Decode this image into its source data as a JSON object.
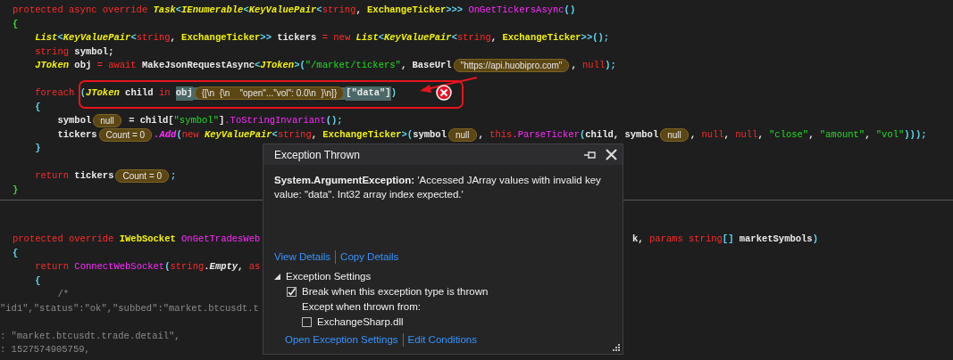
{
  "editor": {
    "blocks": [
      {
        "lines": [
          {
            "tokens": [
              {
                "kind": "kw",
                "text": "protected async override "
              },
              {
                "kind": "type",
                "text": "Task"
              },
              {
                "kind": "punct",
                "text": "<"
              },
              {
                "kind": "type",
                "text": "IEnumerable"
              },
              {
                "kind": "punct",
                "text": "<"
              },
              {
                "kind": "type",
                "text": "KeyValuePair"
              },
              {
                "kind": "punct",
                "text": "<"
              },
              {
                "kind": "kw",
                "text": "string"
              },
              {
                "kind": "plain",
                "text": ", "
              },
              {
                "kind": "cls",
                "text": "ExchangeTicker"
              },
              {
                "kind": "punct",
                "text": ">>> "
              },
              {
                "kind": "fn",
                "text": "OnGetTickersAsync"
              },
              {
                "kind": "punct",
                "text": "()"
              }
            ]
          },
          {
            "tokens": [
              {
                "kind": "bracket",
                "text": "{"
              }
            ]
          },
          {
            "tokens": [
              {
                "kind": "type",
                "text": "    List"
              },
              {
                "kind": "punct",
                "text": "<"
              },
              {
                "kind": "type",
                "text": "KeyValuePair"
              },
              {
                "kind": "punct",
                "text": "<"
              },
              {
                "kind": "kw",
                "text": "string"
              },
              {
                "kind": "plain",
                "text": ", "
              },
              {
                "kind": "cls",
                "text": "ExchangeTicker"
              },
              {
                "kind": "punct",
                "text": ">>"
              },
              {
                "kind": "plain",
                "text": " tickers "
              },
              {
                "kind": "kw",
                "text": "= new "
              },
              {
                "kind": "type",
                "text": "List"
              },
              {
                "kind": "punct",
                "text": "<"
              },
              {
                "kind": "type",
                "text": "KeyValuePair"
              },
              {
                "kind": "punct",
                "text": "<"
              },
              {
                "kind": "kw",
                "text": "string"
              },
              {
                "kind": "plain",
                "text": ", "
              },
              {
                "kind": "cls",
                "text": "ExchangeTicker"
              },
              {
                "kind": "punct",
                "text": ">>();"
              }
            ]
          },
          {
            "tokens": [
              {
                "kind": "kw",
                "text": "    string"
              },
              {
                "kind": "plain",
                "text": " symbol;"
              }
            ]
          },
          {
            "tokens": [
              {
                "kind": "type",
                "text": "    JToken"
              },
              {
                "kind": "plain",
                "text": " obj "
              },
              {
                "kind": "kw",
                "text": "= await "
              },
              {
                "kind": "plain",
                "text": "MakeJsonRequestAsync"
              },
              {
                "kind": "punct",
                "text": "<"
              },
              {
                "kind": "type",
                "text": "JToken"
              },
              {
                "kind": "punct",
                "text": ">("
              },
              {
                "kind": "str",
                "text": "\"/market/tickers\""
              },
              {
                "kind": "plain",
                "text": ", BaseUrl"
              },
              {
                "kind": "tip",
                "text": "\"https://api.huobipro.com\""
              },
              {
                "kind": "plain",
                "text": ", "
              },
              {
                "kind": "kw",
                "text": "null"
              },
              {
                "kind": "punct",
                "text": ");"
              }
            ]
          },
          {
            "blank": true
          },
          {
            "tokens": [
              {
                "kind": "kw",
                "text": "    foreach "
              },
              {
                "kind": "punct",
                "text": "("
              },
              {
                "kind": "type",
                "text": "JToken"
              },
              {
                "kind": "plain",
                "text": " child "
              },
              {
                "kind": "kw",
                "text": "in "
              },
              {
                "kind": "plain",
                "text": "obj",
                "highlighted": true
              },
              {
                "kind": "tip",
                "text": "{[\\n  {\\n    \"open\"...\"vol\": 0.0\\n  }\\n]}",
                "highlighted": true
              },
              {
                "kind": "plain",
                "text": "[\"data\"]",
                "highlighted": true
              },
              {
                "kind": "punct",
                "text": ")"
              }
            ]
          },
          {
            "tokens": [
              {
                "kind": "punct",
                "text": "    {"
              }
            ]
          },
          {
            "tokens": [
              {
                "kind": "plain",
                "text": "        symbol"
              },
              {
                "kind": "tip",
                "text": "null"
              },
              {
                "kind": "plain",
                "text": " = child["
              },
              {
                "kind": "str",
                "text": "\"symbol\""
              },
              {
                "kind": "plain",
                "text": "]"
              },
              {
                "kind": "fn",
                "text": ".ToStringInvariant"
              },
              {
                "kind": "punct",
                "text": "();"
              }
            ]
          },
          {
            "tokens": [
              {
                "kind": "plain",
                "text": "        tickers"
              },
              {
                "kind": "tip",
                "text": "Count = 0"
              },
              {
                "kind": "fni",
                "text": ".Add"
              },
              {
                "kind": "punct",
                "text": "("
              },
              {
                "kind": "kw",
                "text": "new "
              },
              {
                "kind": "type",
                "text": "KeyValuePair"
              },
              {
                "kind": "punct",
                "text": "<"
              },
              {
                "kind": "kw",
                "text": "string"
              },
              {
                "kind": "plain",
                "text": ", "
              },
              {
                "kind": "cls",
                "text": "ExchangeTicker"
              },
              {
                "kind": "punct",
                "text": ">("
              },
              {
                "kind": "plain",
                "text": "symbol"
              },
              {
                "kind": "tip",
                "text": "null"
              },
              {
                "kind": "plain",
                "text": ", "
              },
              {
                "kind": "kw",
                "text": "this"
              },
              {
                "kind": "fn",
                "text": ".ParseTicker"
              },
              {
                "kind": "punct",
                "text": "("
              },
              {
                "kind": "plain",
                "text": "child, symbol"
              },
              {
                "kind": "tip",
                "text": "null"
              },
              {
                "kind": "plain",
                "text": ", "
              },
              {
                "kind": "kw",
                "text": "null"
              },
              {
                "kind": "plain",
                "text": ", "
              },
              {
                "kind": "kw",
                "text": "null"
              },
              {
                "kind": "plain",
                "text": ", "
              },
              {
                "kind": "str",
                "text": "\"close\""
              },
              {
                "kind": "plain",
                "text": ", "
              },
              {
                "kind": "str",
                "text": "\"amount\""
              },
              {
                "kind": "plain",
                "text": ", "
              },
              {
                "kind": "str",
                "text": "\"vol\""
              },
              {
                "kind": "punct",
                "text": ")));"
              }
            ]
          },
          {
            "tokens": [
              {
                "kind": "punct",
                "text": "    }"
              }
            ]
          },
          {
            "blank": true
          },
          {
            "tokens": [
              {
                "kind": "kw",
                "text": "    return "
              },
              {
                "kind": "plain",
                "text": "tickers"
              },
              {
                "kind": "tip",
                "text": "Count = 0"
              },
              {
                "kind": "punct",
                "text": ";"
              }
            ]
          },
          {
            "tokens": [
              {
                "kind": "bracket",
                "text": "}"
              }
            ]
          }
        ]
      },
      {
        "lines": [
          {
            "blank": true
          },
          {
            "blank": true
          },
          {
            "tokens": [
              {
                "kind": "kw",
                "text": "protected override "
              },
              {
                "kind": "cls",
                "text": "IWebSocket "
              },
              {
                "kind": "fn",
                "text": "OnGetTradesWeb"
              }
            ],
            "right": [
              {
                "kind": "plain",
                "text": "k, "
              },
              {
                "kind": "kw",
                "text": "params string"
              },
              {
                "kind": "punct",
                "text": "[] "
              },
              {
                "kind": "plain",
                "text": "marketSymbols"
              },
              {
                "kind": "punct",
                "text": ")"
              }
            ]
          },
          {
            "tokens": [
              {
                "kind": "punct",
                "text": "{"
              }
            ]
          },
          {
            "tokens": [
              {
                "kind": "kw",
                "text": "    return "
              },
              {
                "kind": "fn",
                "text": "ConnectWebSocket"
              },
              {
                "kind": "punct",
                "text": "("
              },
              {
                "kind": "kw",
                "text": "string"
              },
              {
                "kind": "plain",
                "text": "."
              },
              {
                "kind": "italic",
                "text": "Empty"
              },
              {
                "kind": "plain",
                "text": ", "
              },
              {
                "kind": "kw",
                "text": "as"
              }
            ]
          },
          {
            "tokens": [
              {
                "kind": "punct",
                "text": "    {"
              }
            ]
          },
          {
            "tokens": [
              {
                "kind": "comment",
                "text": "        /*"
              }
            ]
          },
          {
            "scrolled": true,
            "tokens": [
              {
                "kind": "comment",
                "text": "\"id1\",\"status\":\"ok\",\"subbed\":\"market.btcusdt.t"
              }
            ]
          },
          {
            "blank": true
          },
          {
            "scrolled": true,
            "tokens": [
              {
                "kind": "comment",
                "text": ": \"market.btcusdt.trade.detail\","
              }
            ]
          },
          {
            "scrolled": true,
            "tokens": [
              {
                "kind": "comment",
                "text": ": 1527574905759,"
              }
            ]
          }
        ]
      }
    ]
  },
  "exception_popup": {
    "title": "Exception Thrown",
    "message": "**System.ArgumentException:** 'Accessed JArray values with invalid key value: \"data\". Int32 array index expected.'",
    "links": [
      "View Details",
      "Copy Details"
    ],
    "settings": {
      "label": "Exception Settings",
      "expanded": true,
      "break_option": {
        "label": "Break when this exception type is thrown",
        "checked": true
      },
      "except_label": "Except when thrown from:",
      "modules": [
        {
          "label": "ExchangeSharp.dll",
          "checked": false
        }
      ]
    },
    "footer_links": [
      "Open Exception Settings",
      "Edit Conditions"
    ]
  }
}
